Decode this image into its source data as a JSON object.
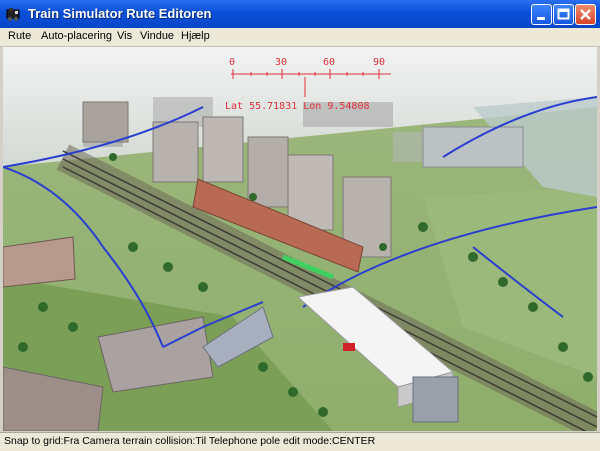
{
  "window": {
    "title": "Train Simulator Rute Editoren",
    "icon": "train-app-icon",
    "controls": [
      "minimize-icon",
      "maximize-icon",
      "close-icon"
    ]
  },
  "menu": {
    "items": [
      "Rute",
      "Auto-placering",
      "Vis",
      "Vindue",
      "Hjælp"
    ]
  },
  "hud": {
    "compass_ticks": [
      "0",
      "30",
      "60",
      "90"
    ],
    "position_readout": "Lat 55.71831 Lon 9.54808"
  },
  "status": {
    "text": "Snap to grid:Fra Camera terrain collision:Til Telephone pole edit mode:CENTER"
  },
  "colors": {
    "titlebar": "#0a4fd8",
    "hud": "#e0303a",
    "track_line": "#2a3fd0",
    "grass": "#7fa85a"
  }
}
